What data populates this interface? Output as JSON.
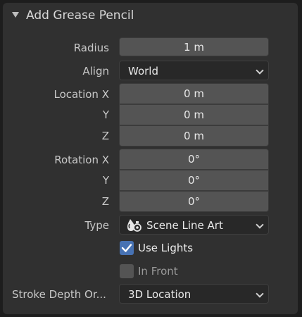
{
  "panel": {
    "title": "Add Grease Pencil"
  },
  "radius": {
    "label": "Radius",
    "value": "1 m"
  },
  "align": {
    "label": "Align",
    "value": "World"
  },
  "location": {
    "label_x": "Location X",
    "label_y": "Y",
    "label_z": "Z",
    "x": "0 m",
    "y": "0 m",
    "z": "0 m"
  },
  "rotation": {
    "label_x": "Rotation X",
    "label_y": "Y",
    "label_z": "Z",
    "x": "0°",
    "y": "0°",
    "z": "0°"
  },
  "type": {
    "label": "Type",
    "value": "Scene Line Art",
    "icon": "scene-line-art-icon"
  },
  "use_lights": {
    "label": "Use Lights",
    "checked": true
  },
  "in_front": {
    "label": "In Front",
    "checked": false
  },
  "stroke_depth_order": {
    "label": "Stroke Depth Or...",
    "value": "3D Location"
  },
  "colors": {
    "accent": "#4772b3",
    "panel": "#303030",
    "field": "#545454",
    "dropdown": "#282828"
  }
}
